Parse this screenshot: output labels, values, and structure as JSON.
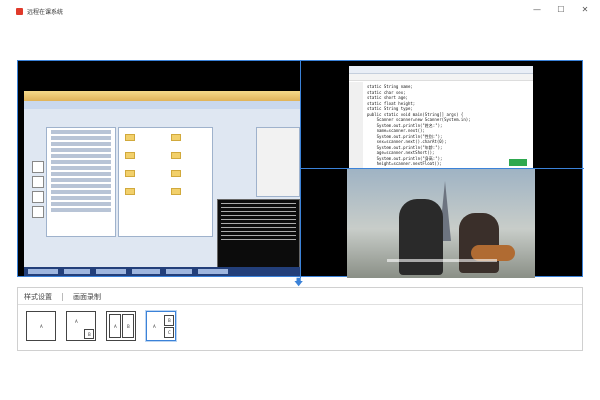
{
  "window": {
    "title": "远程在课系统",
    "controls": {
      "minimize": "—",
      "maximize": "☐",
      "close": "✕"
    }
  },
  "code": {
    "lines": [
      "static String name;",
      "static char sex;",
      "static short age;",
      "static float height;",
      "static String type;",
      "public static void main(String[] args) {",
      "    Scanner scanner=new Scanner(System.in);",
      "    System.out.println(\"姓名:\");",
      "    name=scanner.next();",
      "    System.out.println(\"性别:\");",
      "    sex=scanner.next().charAt(0);",
      "    System.out.println(\"年龄:\");",
      "    age=scanner.nextShort();",
      "    System.out.println(\"身高:\");",
      "    height=scanner.nextFloat();"
    ]
  },
  "arrow": "🡇",
  "settings": {
    "tabs": [
      "样式设置",
      "画面录制"
    ],
    "active_tab": 0,
    "layouts": [
      {
        "name": "single",
        "labels": [
          "A"
        ]
      },
      {
        "name": "pip",
        "labels": [
          "A",
          "B"
        ]
      },
      {
        "name": "side-by-side",
        "labels": [
          "A",
          "B"
        ]
      },
      {
        "name": "one-plus-two",
        "labels": [
          "A",
          "B",
          "C"
        ]
      }
    ],
    "selected_layout": 3
  }
}
